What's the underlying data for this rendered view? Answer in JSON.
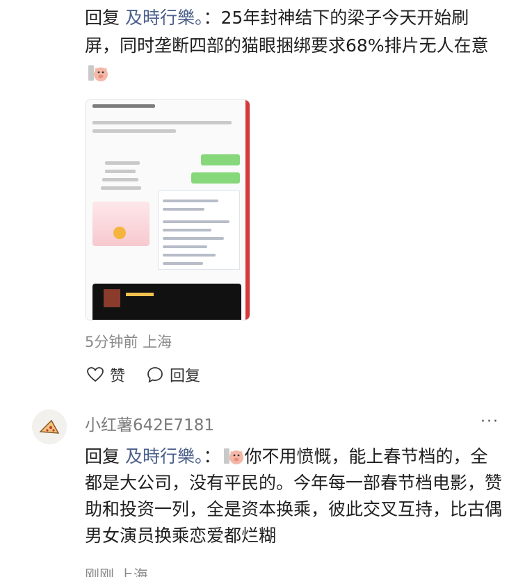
{
  "comment1": {
    "reply_prefix": "回复 ",
    "reply_to": "及時行樂。",
    "separator": "：",
    "text": "25年封神结下的梁子今天开始刷屏，同时垄断四部的猫眼捆绑要求68%排片无人在意",
    "sticker_icon": "pig-sticker-icon",
    "time": "5分钟前",
    "location": "上海",
    "like_label": "赞",
    "reply_label": "回复"
  },
  "comment2": {
    "username": "小红薯642E7181",
    "more_label": "···",
    "reply_prefix": "回复 ",
    "reply_to": "及時行樂。",
    "separator": "：",
    "text": "你不用愤慨，能上春节档的，全都是大公司，没有平民的。今年每一部春节档电影，赞助和投资一列，全是资本换乘，彼此交叉互持，比古偶男女演员换乘恋爱都烂糊",
    "sticker_icon": "pig-sticker-icon",
    "time": "刚刚",
    "location": "上海"
  },
  "colors": {
    "text": "#1f1f1f",
    "meta": "#8a8a8a",
    "username_link": "#4b5f8a"
  }
}
